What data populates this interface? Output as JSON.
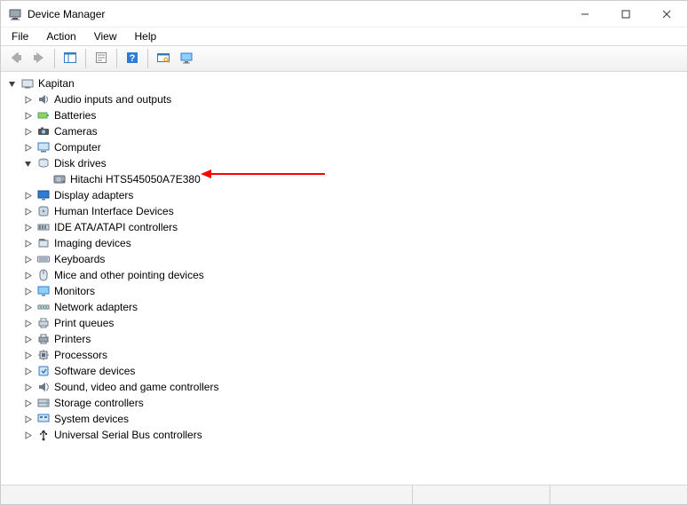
{
  "titlebar": {
    "title": "Device Manager"
  },
  "menu": {
    "file": "File",
    "action": "Action",
    "view": "View",
    "help": "Help"
  },
  "tree": {
    "root": {
      "label": "Kapitan",
      "expanded": true
    },
    "items": [
      {
        "label": "Audio inputs and outputs",
        "icon": "audio",
        "expanded": false,
        "hasChildren": true
      },
      {
        "label": "Batteries",
        "icon": "battery",
        "expanded": false,
        "hasChildren": true
      },
      {
        "label": "Cameras",
        "icon": "camera",
        "expanded": false,
        "hasChildren": true
      },
      {
        "label": "Computer",
        "icon": "computer",
        "expanded": false,
        "hasChildren": true
      },
      {
        "label": "Disk drives",
        "icon": "disk",
        "expanded": true,
        "hasChildren": true,
        "children": [
          {
            "label": "Hitachi HTS545050A7E380",
            "icon": "hdd"
          }
        ]
      },
      {
        "label": "Display adapters",
        "icon": "display",
        "expanded": false,
        "hasChildren": true
      },
      {
        "label": "Human Interface Devices",
        "icon": "hid",
        "expanded": false,
        "hasChildren": true
      },
      {
        "label": "IDE ATA/ATAPI controllers",
        "icon": "ide",
        "expanded": false,
        "hasChildren": true
      },
      {
        "label": "Imaging devices",
        "icon": "imaging",
        "expanded": false,
        "hasChildren": true
      },
      {
        "label": "Keyboards",
        "icon": "keyboard",
        "expanded": false,
        "hasChildren": true
      },
      {
        "label": "Mice and other pointing devices",
        "icon": "mouse",
        "expanded": false,
        "hasChildren": true
      },
      {
        "label": "Monitors",
        "icon": "monitor",
        "expanded": false,
        "hasChildren": true
      },
      {
        "label": "Network adapters",
        "icon": "network",
        "expanded": false,
        "hasChildren": true
      },
      {
        "label": "Print queues",
        "icon": "printqueue",
        "expanded": false,
        "hasChildren": true
      },
      {
        "label": "Printers",
        "icon": "printer",
        "expanded": false,
        "hasChildren": true
      },
      {
        "label": "Processors",
        "icon": "cpu",
        "expanded": false,
        "hasChildren": true
      },
      {
        "label": "Software devices",
        "icon": "software",
        "expanded": false,
        "hasChildren": true
      },
      {
        "label": "Sound, video and game controllers",
        "icon": "sound",
        "expanded": false,
        "hasChildren": true
      },
      {
        "label": "Storage controllers",
        "icon": "storage",
        "expanded": false,
        "hasChildren": true
      },
      {
        "label": "System devices",
        "icon": "system",
        "expanded": false,
        "hasChildren": true
      },
      {
        "label": "Universal Serial Bus controllers",
        "icon": "usb",
        "expanded": false,
        "hasChildren": true
      }
    ]
  },
  "annotation": {
    "color": "#ff0000"
  }
}
